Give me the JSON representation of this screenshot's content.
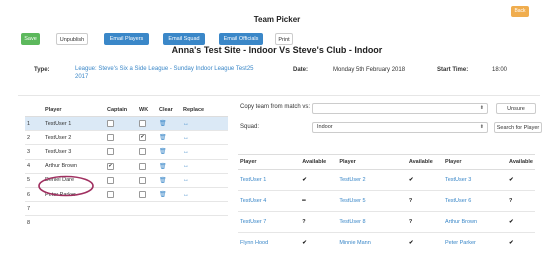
{
  "header": {
    "title": "Team Picker",
    "back_label": "Back"
  },
  "toolbar": {
    "save_label": "Save",
    "unpublish_label": "Unpublish",
    "email_players_label": "Email Players",
    "email_squad_label": "Email Squad",
    "email_officials_label": "Email Officials",
    "print_label": "Print"
  },
  "match": {
    "heading": "Anna's Test Site - Indoor Vs Steve's Club - Indoor",
    "type_label": "Type:",
    "type_value": "League: Steve's Six a Side League - Sunday Indoor League Test25 2017",
    "date_label": "Date:",
    "date_value": "Monday 5th February 2018",
    "start_label": "Start Time:",
    "start_value": "18:00"
  },
  "team_table": {
    "headers": [
      "",
      "Player",
      "Captain",
      "WK",
      "Clear",
      "Replace"
    ],
    "rows": [
      {
        "num": "1",
        "player": "TestUser 1",
        "captain": false,
        "wk": false
      },
      {
        "num": "2",
        "player": "TestUser 2",
        "captain": false,
        "wk": true
      },
      {
        "num": "3",
        "player": "TestUser 3",
        "captain": false,
        "wk": false
      },
      {
        "num": "4",
        "player": "Arthur Brown",
        "captain": true,
        "wk": false
      },
      {
        "num": "5",
        "player": "Deniel Dare",
        "captain": false,
        "wk": false
      },
      {
        "num": "6",
        "player": "Peter Parker",
        "captain": false,
        "wk": false
      },
      {
        "num": "7",
        "player": "",
        "captain": false,
        "wk": false
      },
      {
        "num": "8",
        "player": "",
        "captain": false,
        "wk": false
      }
    ]
  },
  "copy_team": {
    "label": "Copy team from match vs:",
    "value": "",
    "unsure_label": "Unsure"
  },
  "squad": {
    "label": "Squad:",
    "value": "Indoor",
    "search_label": "Search for Player"
  },
  "avail_table": {
    "headers": [
      "Player",
      "Available",
      "Player",
      "Available",
      "Player",
      "Available"
    ],
    "rows": [
      [
        "TestUser 1",
        "✔",
        "TestUser 2",
        "✔",
        "TestUser 3",
        "✔"
      ],
      [
        "TestUser 4",
        "━",
        "TestUser 5",
        "?",
        "TestUser 6",
        "?"
      ],
      [
        "TestUser 7",
        "?",
        "TestUser 8",
        "?",
        "Arthur Brown",
        "✔"
      ],
      [
        "Flynn Hood",
        "✔",
        "Minnie Mann",
        "✔",
        "Peter Parker",
        "✔"
      ]
    ]
  },
  "colors": {
    "blue": "#3a87c8",
    "green": "#5cb85c",
    "orange": "#f0ad4e",
    "highlight": "#a03060"
  }
}
